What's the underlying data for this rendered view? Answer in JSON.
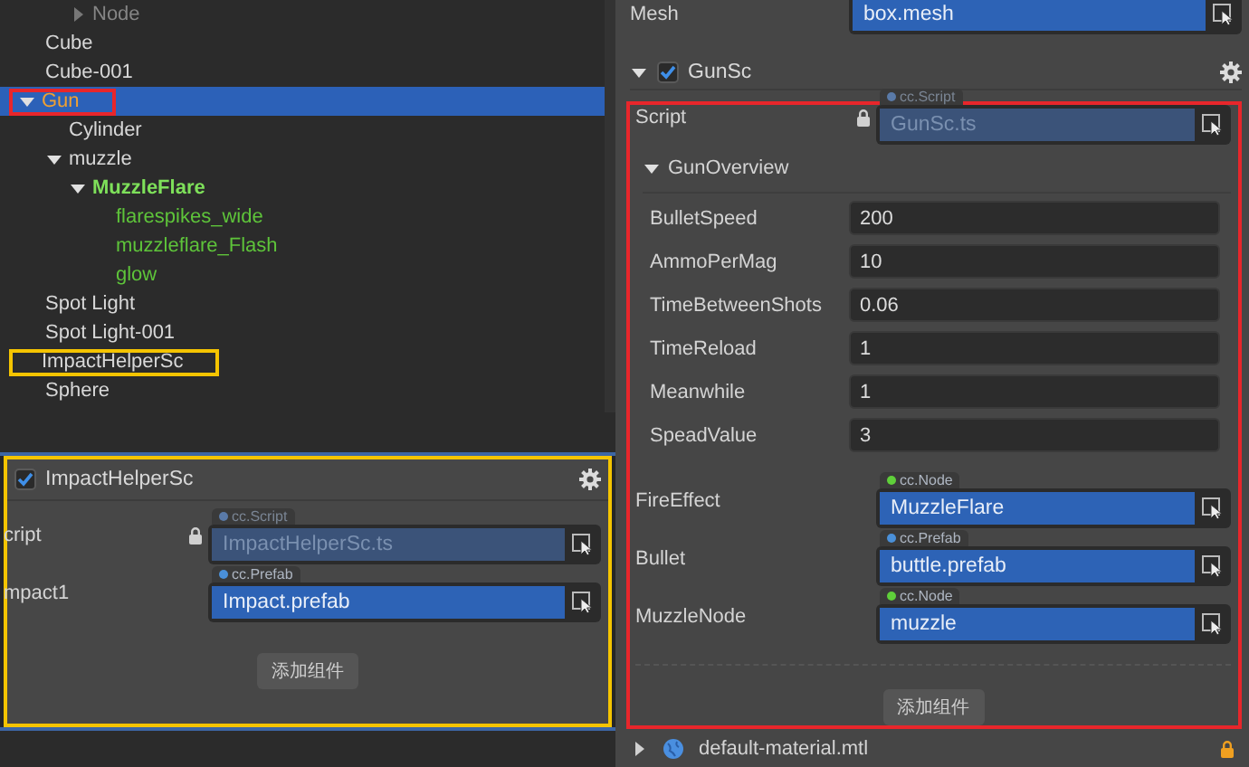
{
  "hierarchy": {
    "items": [
      {
        "children": [
          {
            "label": "Node",
            "kind": "node",
            "dimmed": true,
            "has_children": true,
            "expanded": false,
            "selected": false
          }
        ]
      },
      {
        "label": "Cube",
        "kind": "node",
        "selected": false
      },
      {
        "label": "Cube-001",
        "kind": "node",
        "selected": false
      },
      {
        "label": "Gun",
        "kind": "node",
        "selected": true,
        "expanded": true,
        "has_children": true,
        "frame": {
          "color": "#e8262b"
        },
        "children": [
          {
            "label": "Cylinder",
            "kind": "node",
            "selected": false
          },
          {
            "label": "muzzle",
            "kind": "node",
            "selected": false,
            "expanded": true,
            "has_children": true,
            "children": [
              {
                "label": "MuzzleFlare",
                "kind": "prefab-root",
                "selected": false,
                "expanded": true,
                "has_children": true,
                "children": [
                  {
                    "label": "flarespikes_wide",
                    "kind": "prefab-child",
                    "selected": false
                  },
                  {
                    "label": "muzzleflare_Flash",
                    "kind": "prefab-child",
                    "selected": false
                  },
                  {
                    "label": "glow",
                    "kind": "prefab-child",
                    "selected": false
                  }
                ]
              }
            ]
          }
        ]
      },
      {
        "label": "Spot Light",
        "kind": "node",
        "selected": false
      },
      {
        "label": "Spot Light-001",
        "kind": "node",
        "selected": false
      },
      {
        "label": "ImpactHelperSc",
        "kind": "node",
        "selected": false,
        "frame": {
          "color": "#f5c400"
        }
      },
      {
        "label": "Sphere",
        "kind": "node",
        "selected": false
      }
    ]
  },
  "left_inspector": {
    "frame": {
      "color": "#f5c400"
    },
    "component": {
      "name": "ImpactHelperSc",
      "enabled": true,
      "script": {
        "label": "cript",
        "type_tag": "cc.Script",
        "value": "ImpactHelperSc.ts"
      },
      "properties": [
        {
          "label": "mpact1",
          "type_tag": "cc.Prefab",
          "color": "#4a90d9",
          "value": "Impact.prefab"
        }
      ]
    },
    "add_button": "添加组件"
  },
  "right_inspector": {
    "mesh_row": {
      "label": "Mesh",
      "value": "box.mesh"
    },
    "component": {
      "name": "GunSc",
      "expanded": true,
      "enabled": true,
      "frame": {
        "color": "#e8262b"
      },
      "script": {
        "label": "Script",
        "type_tag": "cc.Script",
        "value": "GunSc.ts"
      },
      "groups": [
        {
          "name": "GunOverview",
          "expanded": true,
          "fields": [
            {
              "label": "BulletSpeed",
              "value": "200"
            },
            {
              "label": "AmmoPerMag",
              "value": "10"
            },
            {
              "label": "TimeBetweenShots",
              "value": "0.06"
            },
            {
              "label": "TimeReload",
              "value": "1"
            },
            {
              "label": "Meanwhile",
              "value": "1"
            },
            {
              "label": "SpeadValue",
              "value": "3"
            }
          ]
        }
      ],
      "properties": [
        {
          "label": "FireEffect",
          "type_tag": "cc.Node",
          "color": "#5fcf3a",
          "value": "MuzzleFlare"
        },
        {
          "label": "Bullet",
          "type_tag": "cc.Prefab",
          "color": "#4a90d9",
          "value": "buttle.prefab"
        },
        {
          "label": "MuzzleNode",
          "type_tag": "cc.Node",
          "color": "#5fcf3a",
          "value": "muzzle"
        }
      ]
    },
    "add_button": "添加组件",
    "asset_row": {
      "name": "default-material.mtl",
      "expanded": false,
      "locked": true
    }
  }
}
